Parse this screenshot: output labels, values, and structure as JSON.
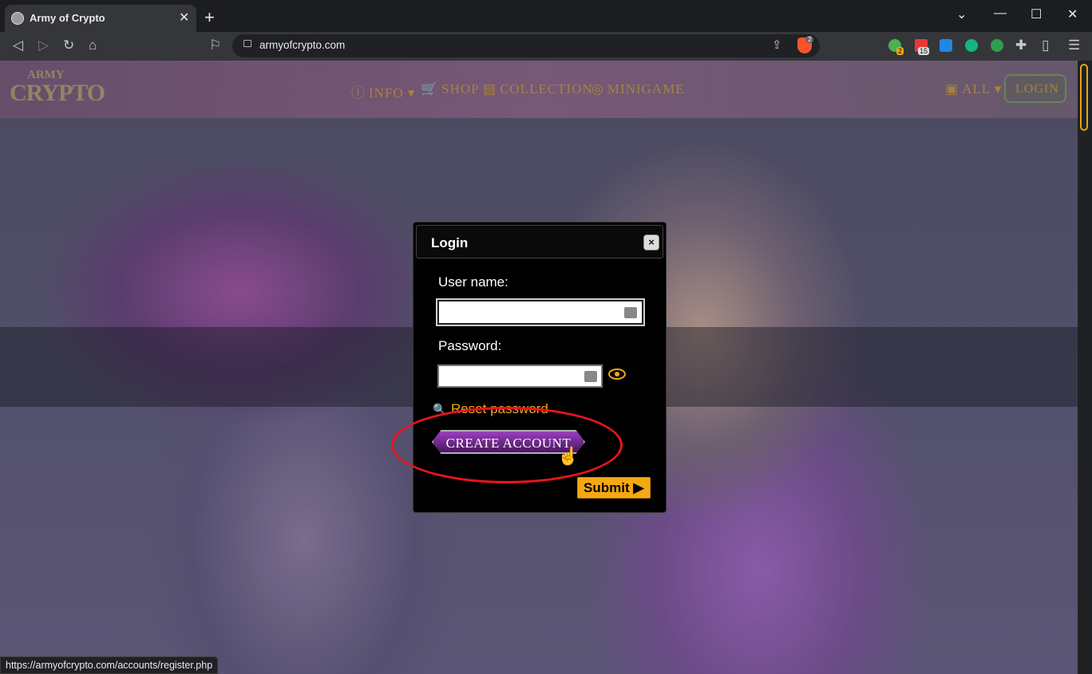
{
  "browser": {
    "tab_title": "Army of Crypto",
    "url": "armyofcrypto.com",
    "status_url": "https://armyofcrypto.com/accounts/register.php",
    "brave_badge": "2",
    "ext_badges": [
      "2",
      "15"
    ]
  },
  "site": {
    "logo_top": "ARMY",
    "logo_main": "CRYPTO",
    "nav": {
      "info": "INFO",
      "shop": "SHOP",
      "collection": "COLLECTION",
      "minigame": "MINIGAME",
      "all": "ALL",
      "login": "LOGIN"
    }
  },
  "modal": {
    "title": "Login",
    "close": "×",
    "username_label": "User name:",
    "username_value": "",
    "password_label": "Password:",
    "password_value": "",
    "reset_label": "Reset password",
    "create_account_label": "CREATE ACCOUNT",
    "submit_label": "Submit ▶"
  },
  "colors": {
    "accent": "#f5a812",
    "highlight": "#e8141c"
  }
}
